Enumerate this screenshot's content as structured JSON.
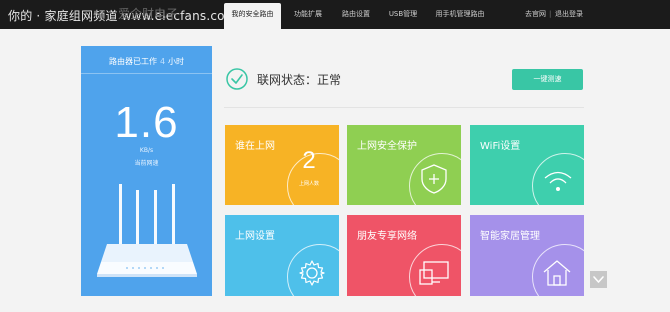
{
  "watermark": "你的 · 家庭组网频道 www.elecfans.com",
  "brand_ghost": "爱企财电子",
  "nav": {
    "tabs": [
      {
        "label": "我的安全路由",
        "active": true
      },
      {
        "label": "功能扩展",
        "active": false
      },
      {
        "label": "路由设置",
        "active": false
      },
      {
        "label": "USB管理",
        "active": false
      },
      {
        "label": "用手机管理路由",
        "active": false
      }
    ],
    "official_site": "去官网",
    "logout": "退出登录",
    "separator": "|"
  },
  "left_panel": {
    "uptime_prefix": "路由器已工作",
    "uptime_value": "4",
    "uptime_unit": "小时",
    "speed_value": "1.6",
    "speed_unit": "KB/s",
    "speed_label": "当前网速"
  },
  "status": {
    "text": "联网状态：正常",
    "test_button": "一键测速"
  },
  "tiles": [
    {
      "title": "谁在上网",
      "color": "#f7b325",
      "count": "2",
      "count_label": "上网人数",
      "icon": "count-ring"
    },
    {
      "title": "上网安全保护",
      "color": "#8fcf52",
      "icon": "shield-icon"
    },
    {
      "title": "WiFi设置",
      "color": "#3ecfad",
      "icon": "wifi-icon"
    },
    {
      "title": "上网设置",
      "color": "#4ec0ea",
      "icon": "gear-icon"
    },
    {
      "title": "朋友专享网络",
      "color": "#ef5467",
      "icon": "screens-icon"
    },
    {
      "title": "智能家居管理",
      "color": "#a591ea",
      "icon": "home-icon"
    }
  ],
  "colors": {
    "topbar": "#1b1b1b",
    "panel_blue": "#4fa3ec",
    "accent_green": "#39c6a5"
  }
}
